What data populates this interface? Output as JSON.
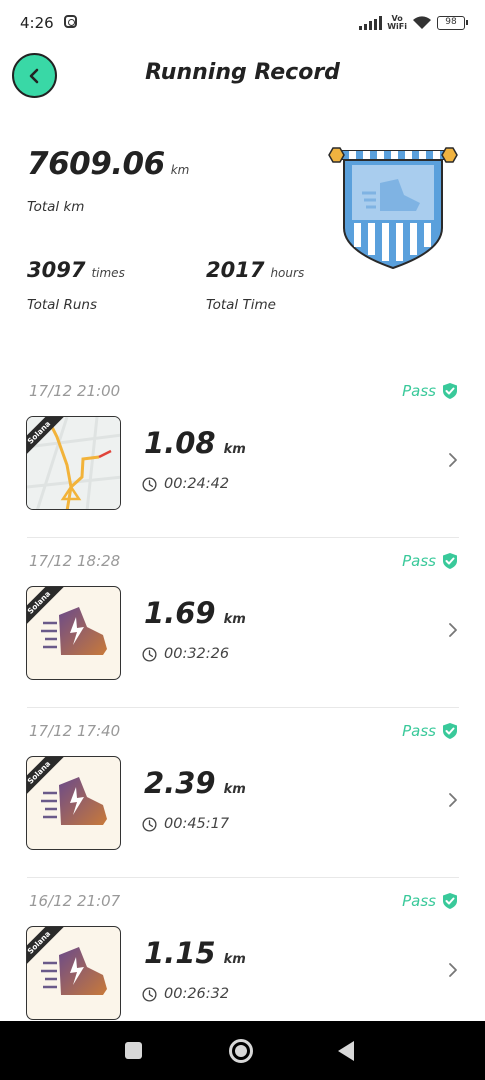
{
  "status_bar": {
    "time": "4:26",
    "network_label_top": "Vo",
    "network_label_bottom": "WiFi",
    "battery": "98"
  },
  "header": {
    "title": "Running Record"
  },
  "summary": {
    "total_km_value": "7609.06",
    "total_km_unit": "km",
    "total_km_label": "Total km",
    "total_runs_value": "3097",
    "total_runs_unit": "times",
    "total_runs_label": "Total Runs",
    "total_time_value": "2017",
    "total_time_unit": "hours",
    "total_time_label": "Total Time"
  },
  "records": [
    {
      "datetime": "17/12 21:00",
      "status": "Pass",
      "distance": "1.08",
      "unit": "km",
      "duration": "00:24:42",
      "tag": "Solana",
      "thumbnail": "map"
    },
    {
      "datetime": "17/12 18:28",
      "status": "Pass",
      "distance": "1.69",
      "unit": "km",
      "duration": "00:32:26",
      "tag": "Solana",
      "thumbnail": "shoe"
    },
    {
      "datetime": "17/12 17:40",
      "status": "Pass",
      "distance": "2.39",
      "unit": "km",
      "duration": "00:45:17",
      "tag": "Solana",
      "thumbnail": "shoe"
    },
    {
      "datetime": "16/12 21:07",
      "status": "Pass",
      "distance": "1.15",
      "unit": "km",
      "duration": "00:26:32",
      "tag": "Solana",
      "thumbnail": "shoe"
    }
  ],
  "colors": {
    "accent": "#39d8a6",
    "pass": "#39c99a",
    "pennant_blue": "#5aa0dc",
    "shoe_gradient_start": "#6a4a8a",
    "shoe_gradient_end": "#c97a3a"
  }
}
